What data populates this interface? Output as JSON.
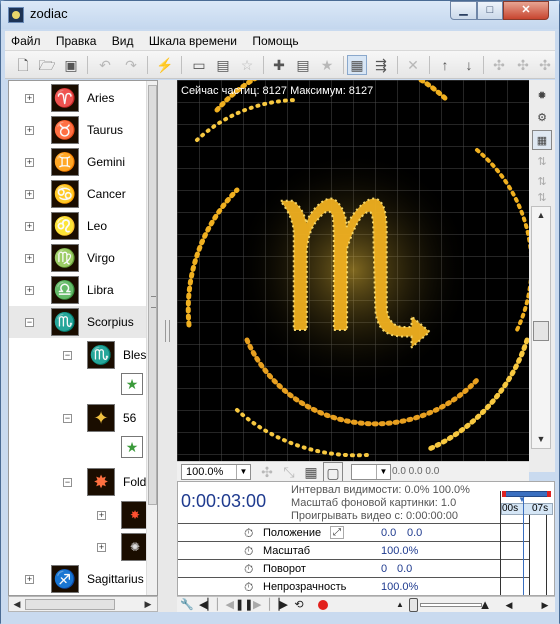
{
  "window": {
    "title": "zodiac"
  },
  "menu": [
    "Файл",
    "Правка",
    "Вид",
    "Шкала времени",
    "Помощь"
  ],
  "tree": {
    "items": [
      {
        "label": "Aries",
        "glyph": "♈"
      },
      {
        "label": "Taurus",
        "glyph": "♉"
      },
      {
        "label": "Gemini",
        "glyph": "♊"
      },
      {
        "label": "Cancer",
        "glyph": "♋"
      },
      {
        "label": "Leo",
        "glyph": "♌"
      },
      {
        "label": "Virgo",
        "glyph": "♍"
      },
      {
        "label": "Libra",
        "glyph": "♎"
      },
      {
        "label": "Scorpius",
        "glyph": "♏"
      }
    ],
    "children": [
      {
        "label": "Bles",
        "glyph": "♏"
      },
      {
        "label": "56",
        "glyph": "✦"
      },
      {
        "label": "Fold",
        "glyph": "✸"
      }
    ],
    "last_item": {
      "label": "Sagittarius",
      "glyph": "♐"
    }
  },
  "canvas": {
    "status": "Сейчас частиц: 8127   Максимум: 8127",
    "glyph": "♏",
    "zoom": "100.0%",
    "coords": "0.0   0.0   0.0"
  },
  "timeline": {
    "time": "0:00:03:00",
    "visibility": "Интервал видимости: 0.0%  100.0%",
    "bg_scale": "Масштаб фоновой картинки: 1.0",
    "play_from": "Проигрывать видео с: 0:00:00:00",
    "ruler": {
      "left": "00s",
      "right": "07s"
    },
    "properties": [
      {
        "label": "Положение",
        "values": [
          "0.0",
          "0.0"
        ]
      },
      {
        "label": "Масштаб",
        "values": [
          "100.0%"
        ]
      },
      {
        "label": "Поворот",
        "values": [
          "0",
          "0.0"
        ]
      },
      {
        "label": "Непрозрачность",
        "values": [
          "100.0%"
        ]
      }
    ]
  },
  "colors": {
    "accent": "#1f3b8f",
    "particle_gold": "#f0b020",
    "record": "#e2201c"
  },
  "icons": {
    "toolbar": [
      "new-file-icon",
      "open-folder-icon",
      "save-icon",
      "undo-icon",
      "redo-icon",
      "wand-icon",
      "folder-icon",
      "clapper-icon",
      "star-icon",
      "add-emitter-icon",
      "add-clip-icon",
      "star-dim-icon",
      "view-mode-1-icon",
      "view-mode-2-icon",
      "delete-icon",
      "move-up-icon",
      "move-down-icon",
      "node-icon-1",
      "node-icon-2",
      "node-icon-3"
    ]
  }
}
